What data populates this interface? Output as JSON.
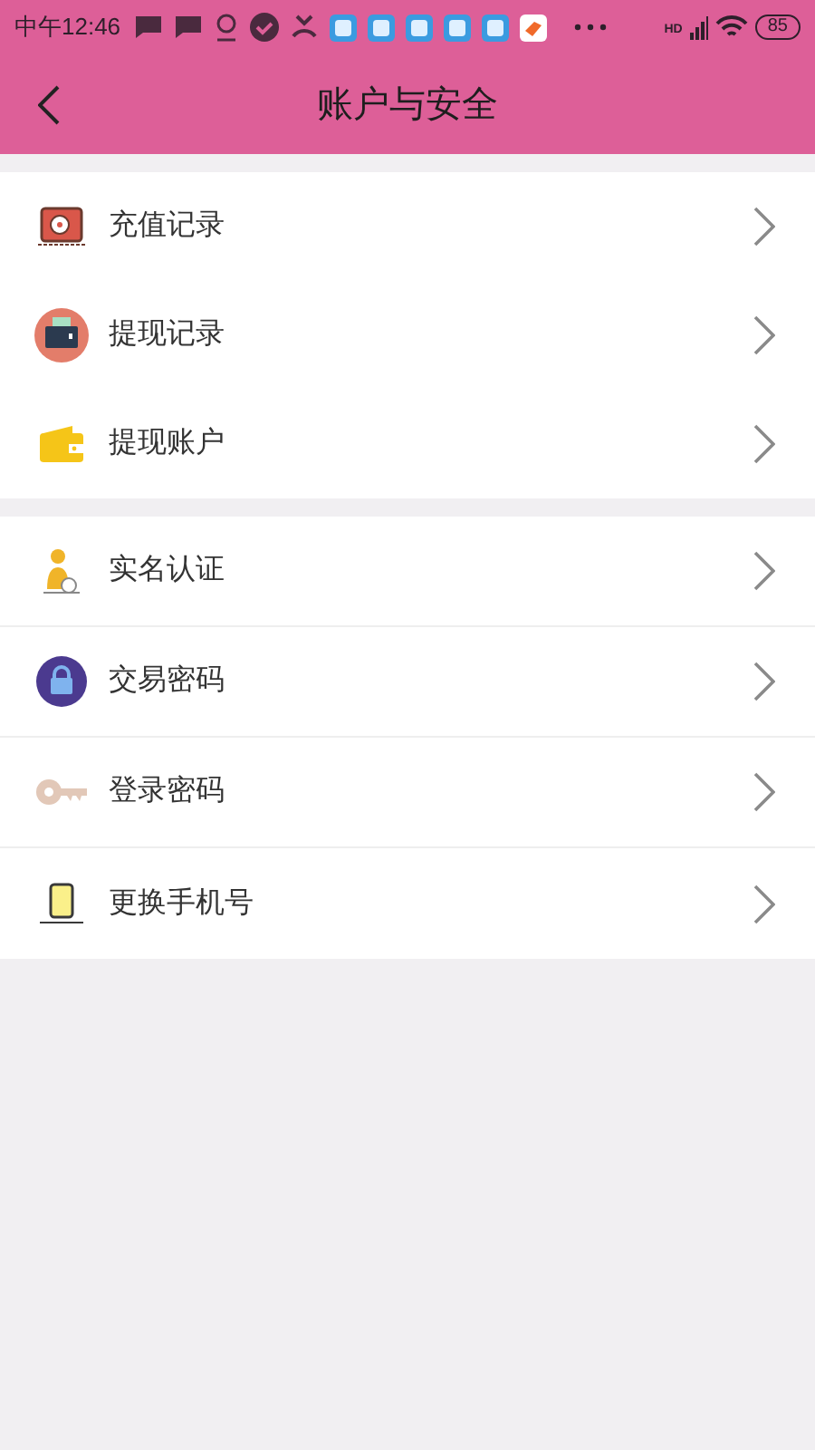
{
  "status_bar": {
    "time": "中午12:46",
    "network": "HD",
    "battery": "85"
  },
  "header": {
    "title": "账户与安全"
  },
  "groups": [
    [
      {
        "label": "充值记录"
      },
      {
        "label": "提现记录"
      },
      {
        "label": "提现账户"
      }
    ],
    [
      {
        "label": "实名认证"
      },
      {
        "label": "交易密码"
      },
      {
        "label": "登录密码"
      },
      {
        "label": "更换手机号"
      }
    ]
  ]
}
